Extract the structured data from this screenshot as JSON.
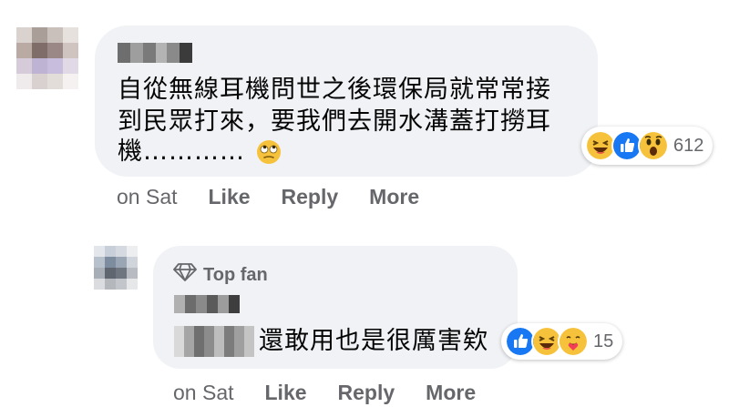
{
  "comment": {
    "text_lines": [
      "自從無線耳機問世之後環保局就常常接",
      "到民眾打來，要我們去開水溝蓋打撈耳",
      "機…………"
    ],
    "text_emoji_icon": "rolling-eyes-emoji",
    "reactions": {
      "icons": [
        "haha-reaction-icon",
        "like-reaction-icon",
        "wow-reaction-icon"
      ],
      "count": "612"
    },
    "actions": {
      "time": "on Sat",
      "like": "Like",
      "reply": "Reply",
      "more": "More"
    }
  },
  "reply": {
    "badge_icon": "diamond-icon",
    "badge_label": "Top fan",
    "text": "還敢用也是很厲害欸",
    "reactions": {
      "icons": [
        "like-reaction-icon",
        "haha-reaction-icon",
        "care-reaction-icon"
      ],
      "count": "15"
    },
    "actions": {
      "time": "on Sat",
      "like": "Like",
      "reply": "Reply",
      "more": "More"
    }
  },
  "colors": {
    "bubble": "#f0f2f5",
    "secondary_text": "#65676b",
    "like_blue": "#1877f2",
    "emoji_yellow": "#f7c23b"
  }
}
